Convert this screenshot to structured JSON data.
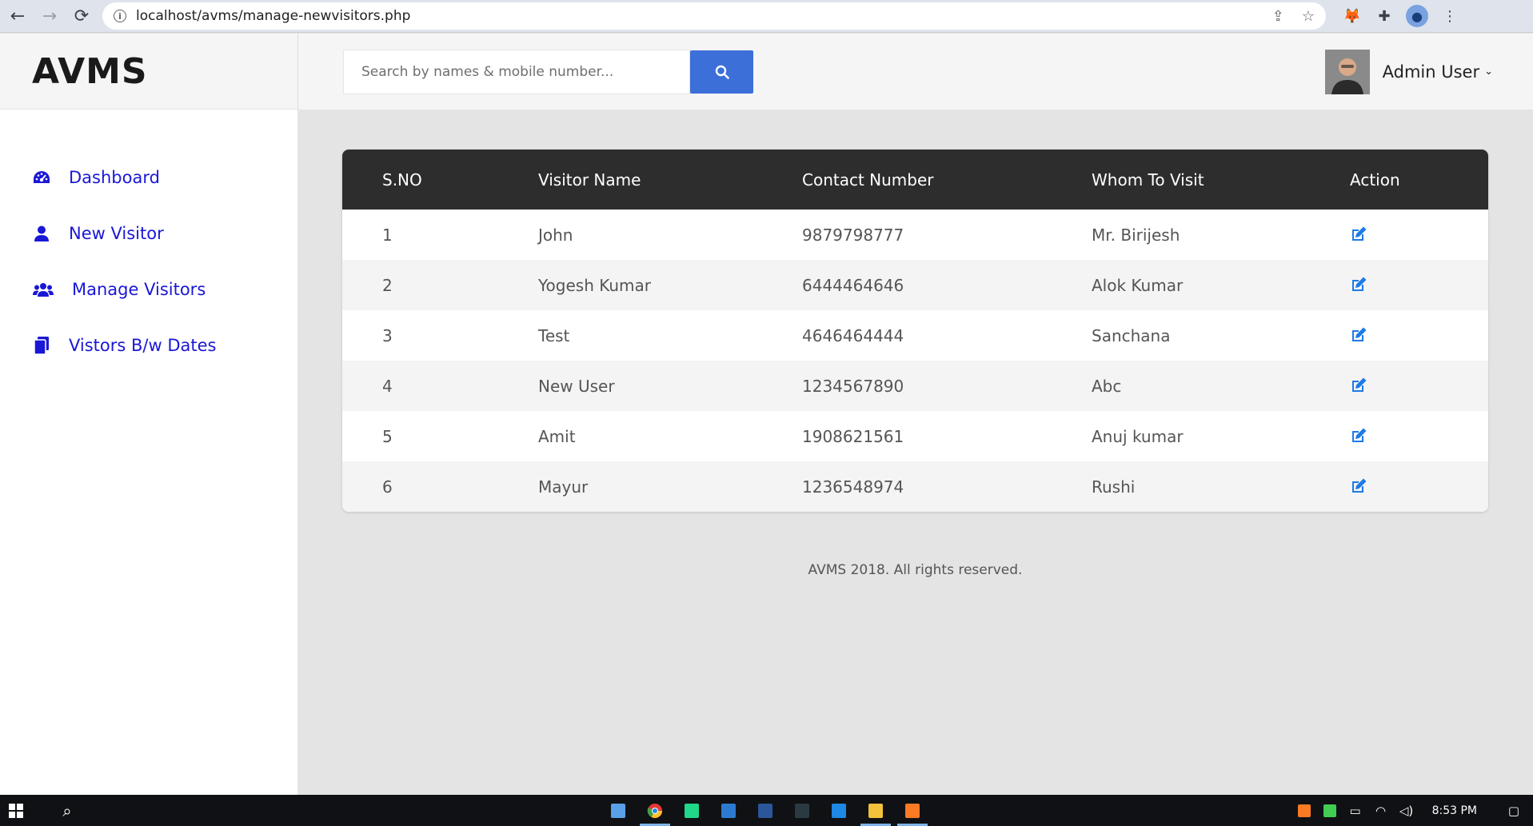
{
  "browser": {
    "url": "localhost/avms/manage-newvisitors.php"
  },
  "sidebar": {
    "brand": "AVMS",
    "items": [
      {
        "label": "Dashboard",
        "icon": "dashboard-icon"
      },
      {
        "label": "New Visitor",
        "icon": "user-icon"
      },
      {
        "label": "Manage Visitors",
        "icon": "users-icon"
      },
      {
        "label": "Vistors B/w Dates",
        "icon": "files-icon"
      }
    ]
  },
  "header": {
    "search_placeholder": "Search by names & mobile number...",
    "user_name": "Admin User",
    "caret": "⌄"
  },
  "table": {
    "columns": [
      "S.NO",
      "Visitor Name",
      "Contact Number",
      "Whom To Visit",
      "Action"
    ],
    "rows": [
      {
        "sno": "1",
        "name": "John",
        "contact": "9879798777",
        "whom": "Mr. Birijesh"
      },
      {
        "sno": "2",
        "name": "Yogesh Kumar",
        "contact": "6444464646",
        "whom": "Alok Kumar"
      },
      {
        "sno": "3",
        "name": "Test",
        "contact": "4646464444",
        "whom": "Sanchana"
      },
      {
        "sno": "4",
        "name": "New User",
        "contact": "1234567890",
        "whom": "Abc"
      },
      {
        "sno": "5",
        "name": "Amit",
        "contact": "1908621561",
        "whom": "Anuj kumar"
      },
      {
        "sno": "6",
        "name": "Mayur",
        "contact": "1236548974",
        "whom": "Rushi"
      }
    ]
  },
  "footer": {
    "text": "AVMS 2018. All rights reserved."
  },
  "taskbar": {
    "clock": "8:53 PM"
  },
  "colors": {
    "accent": "#1a17d6",
    "search_button": "#3c6fd8",
    "table_header": "#2d2d2d",
    "edit_icon": "#1e7ae6"
  }
}
